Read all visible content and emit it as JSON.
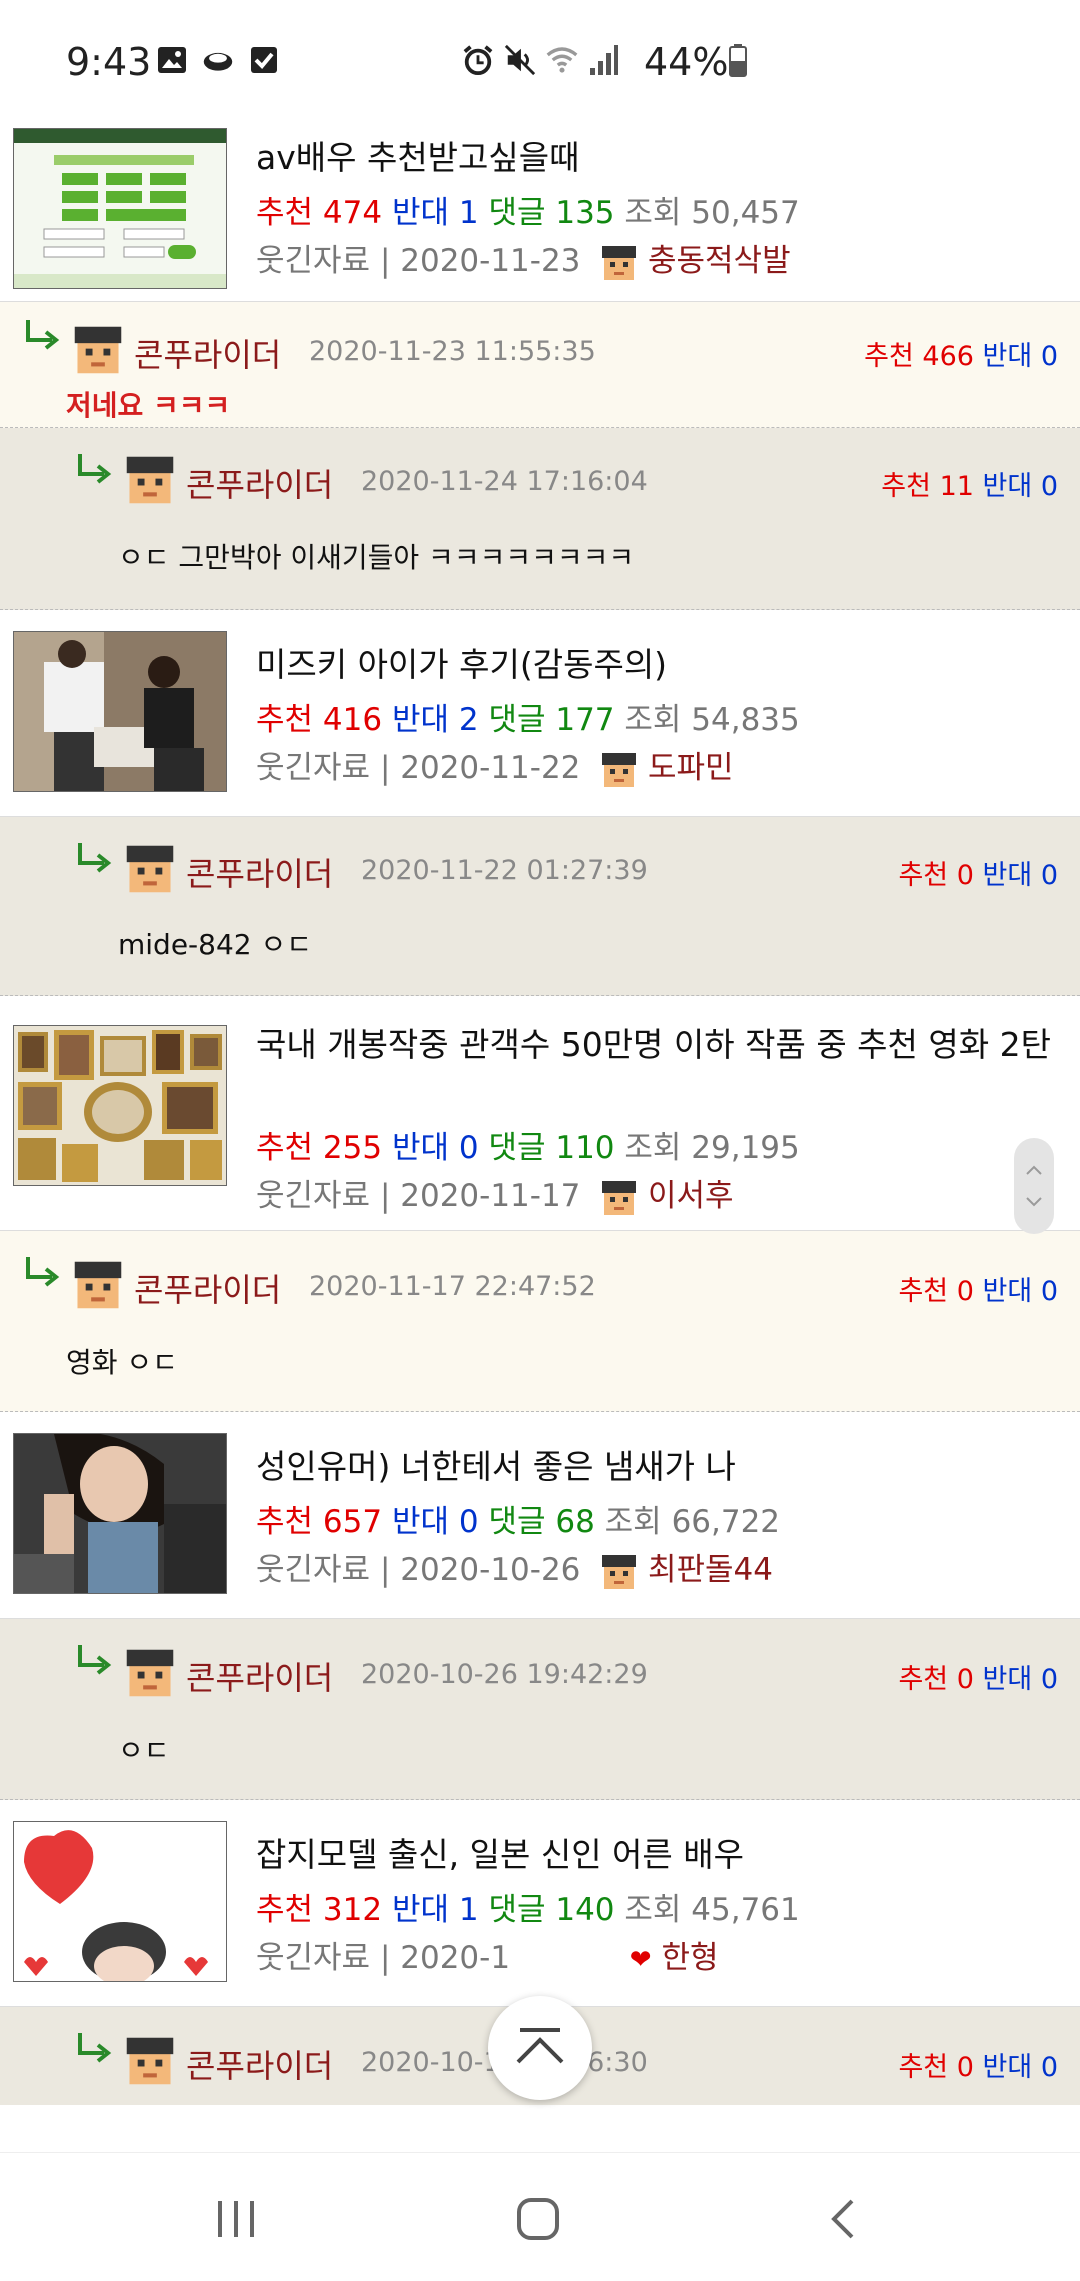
{
  "status_bar": {
    "time": "9:43",
    "battery": "44%"
  },
  "posts": [
    {
      "title": "av배우 추천받고싶을때",
      "up_label": "추천",
      "up": "474",
      "down_label": "반대",
      "down": "1",
      "comments_label": "댓글",
      "comments": "135",
      "views_label": "조회",
      "views": "50,457",
      "category": "웃긴자료",
      "date": "2020-11-23",
      "author": "충동적삭발"
    },
    {
      "title": "미즈키 아이가 후기(감동주의)",
      "up_label": "추천",
      "up": "416",
      "down_label": "반대",
      "down": "2",
      "comments_label": "댓글",
      "comments": "177",
      "views_label": "조회",
      "views": "54,835",
      "category": "웃긴자료",
      "date": "2020-11-22",
      "author": "도파민"
    },
    {
      "title": "국내 개봉작중 관객수 50만명 이하 작품 중 추천 영화 2탄",
      "up_label": "추천",
      "up": "255",
      "down_label": "반대",
      "down": "0",
      "comments_label": "댓글",
      "comments": "110",
      "views_label": "조회",
      "views": "29,195",
      "category": "웃긴자료",
      "date": "2020-11-17",
      "author": "이서후"
    },
    {
      "title": "성인유머) 너한테서 좋은 냄새가 나",
      "up_label": "추천",
      "up": "657",
      "down_label": "반대",
      "down": "0",
      "comments_label": "댓글",
      "comments": "68",
      "views_label": "조회",
      "views": "66,722",
      "category": "웃긴자료",
      "date": "2020-10-26",
      "author": "최판돌44"
    },
    {
      "title": "잡지모델 출신, 일본 신인 어른 배우",
      "up_label": "추천",
      "up": "312",
      "down_label": "반대",
      "down": "1",
      "comments_label": "댓글",
      "comments": "140",
      "views_label": "조회",
      "views": "45,761",
      "category": "웃긴자료",
      "date_partial": "2020-1",
      "author": "한형"
    }
  ],
  "comments": [
    {
      "name": "콘푸라이더",
      "date": "2020-11-23 11:55:35",
      "up_label": "추천",
      "up": "466",
      "down_label": "반대",
      "down": "0",
      "text": "저네요 ㅋㅋㅋ"
    },
    {
      "name": "콘푸라이더",
      "date": "2020-11-24 17:16:04",
      "up_label": "추천",
      "up": "11",
      "down_label": "반대",
      "down": "0",
      "text": "ㅇㄷ 그만박아 이새기들아 ㅋㅋㅋㅋㅋㅋㅋㅋ"
    },
    {
      "name": "콘푸라이더",
      "date": "2020-11-22 01:27:39",
      "up_label": "추천",
      "up": "0",
      "down_label": "반대",
      "down": "0",
      "text": "mide-842 ㅇㄷ"
    },
    {
      "name": "콘푸라이더",
      "date": "2020-11-17 22:47:52",
      "up_label": "추천",
      "up": "0",
      "down_label": "반대",
      "down": "0",
      "text": "영화 ㅇㄷ"
    },
    {
      "name": "콘푸라이더",
      "date": "2020-10-26 19:42:29",
      "up_label": "추천",
      "up": "0",
      "down_label": "반대",
      "down": "0",
      "text": "ㅇㄷ"
    },
    {
      "name": "콘푸라이더",
      "date": "2020-10-15 07:56:30",
      "up_label": "추천",
      "up": "0",
      "down_label": "반대",
      "down": "0"
    }
  ],
  "colors": {
    "up": "#e00000",
    "down": "#0033cc",
    "comments": "#118811",
    "author": "#8b1a1a",
    "reply_bg_1": "#fcf9ef",
    "reply_bg_2": "#ebe8df"
  },
  "icons": [
    "image-icon",
    "cloud-icon",
    "checkbox-icon",
    "alarm-icon",
    "mute-icon",
    "wifi-icon",
    "signal-icon",
    "battery-icon",
    "reply-arrow-icon",
    "avatar-icon",
    "scroll-top-icon",
    "recent-apps-icon",
    "home-icon",
    "back-icon"
  ]
}
